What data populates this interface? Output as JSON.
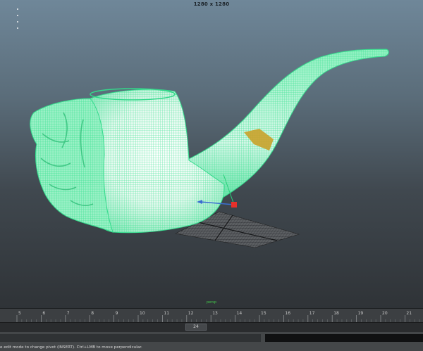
{
  "viewport": {
    "resolution_gate_label": "1280 x 1280",
    "camera_label": "persp",
    "object": "smoking pipe mesh with carved face bowl, wireframe on shaded",
    "colors": {
      "wireframe": "#38e08e",
      "mesh_fill": "#c6f2e0",
      "mesh_fill_light": "#ffffff",
      "band": "#c9a22a",
      "grid": "#1f2226",
      "pivot_handle": "#e8302a",
      "move_axis": "#3a6fd0"
    }
  },
  "timeline": {
    "frame_ticks": [
      "5",
      "6",
      "7",
      "8",
      "9",
      "10",
      "11",
      "12",
      "13",
      "14",
      "15",
      "16",
      "17",
      "18",
      "19",
      "20",
      "21"
    ],
    "current_frame": "24"
  },
  "help_line": {
    "text": "e edit mode to change pivot (INSERT). Ctrl+LMB to move perpendicular."
  }
}
